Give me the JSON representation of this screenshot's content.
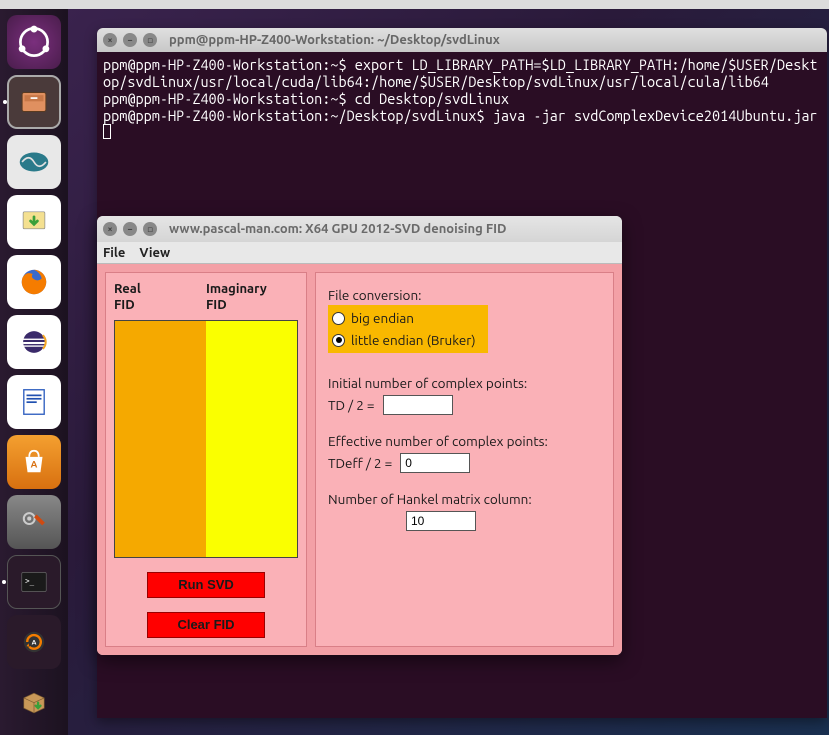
{
  "launcher": {
    "items": [
      "ubuntu-dash",
      "files",
      "data-visualizer",
      "downloads",
      "firefox",
      "eclipse",
      "writer",
      "software-center",
      "system-settings",
      "terminal",
      "software-updater",
      "package-box"
    ]
  },
  "terminal": {
    "title": "ppm@ppm-HP-Z400-Workstation: ~/Desktop/svdLinux",
    "lines": "ppm@ppm-HP-Z400-Workstation:~$ export LD_LIBRARY_PATH=$LD_LIBRARY_PATH:/home/$USER/Desktop/svdLinux/usr/local/cuda/lib64:/home/$USER/Desktop/svdLinux/usr/local/cula/lib64\nppm@ppm-HP-Z400-Workstation:~$ cd Desktop/svdLinux\nppm@ppm-HP-Z400-Workstation:~/Desktop/svdLinux$ java -jar svdComplexDevice2014Ubuntu.jar"
  },
  "app": {
    "title": "www.pascal-man.com: X64 GPU 2012-SVD denoising FID",
    "menu": {
      "file": "File",
      "view": "View"
    },
    "left": {
      "real_header": "Real\nFID",
      "imag_header": "Imaginary\nFID",
      "run_btn": "Run SVD",
      "clear_btn": "Clear FID"
    },
    "right": {
      "file_conv_label": "File conversion:",
      "big_endian": "big endian",
      "little_endian": "little endian (Bruker)",
      "endian_selected": "little",
      "initial_label": "Initial number of complex points:",
      "td_label": "TD / 2 =",
      "td_value": "",
      "effective_label": "Effective number of complex points:",
      "tdeff_label": "TDeff / 2 =",
      "tdeff_value": "0",
      "hankel_label": "Number of Hankel matrix column:",
      "hankel_value": "10"
    }
  }
}
